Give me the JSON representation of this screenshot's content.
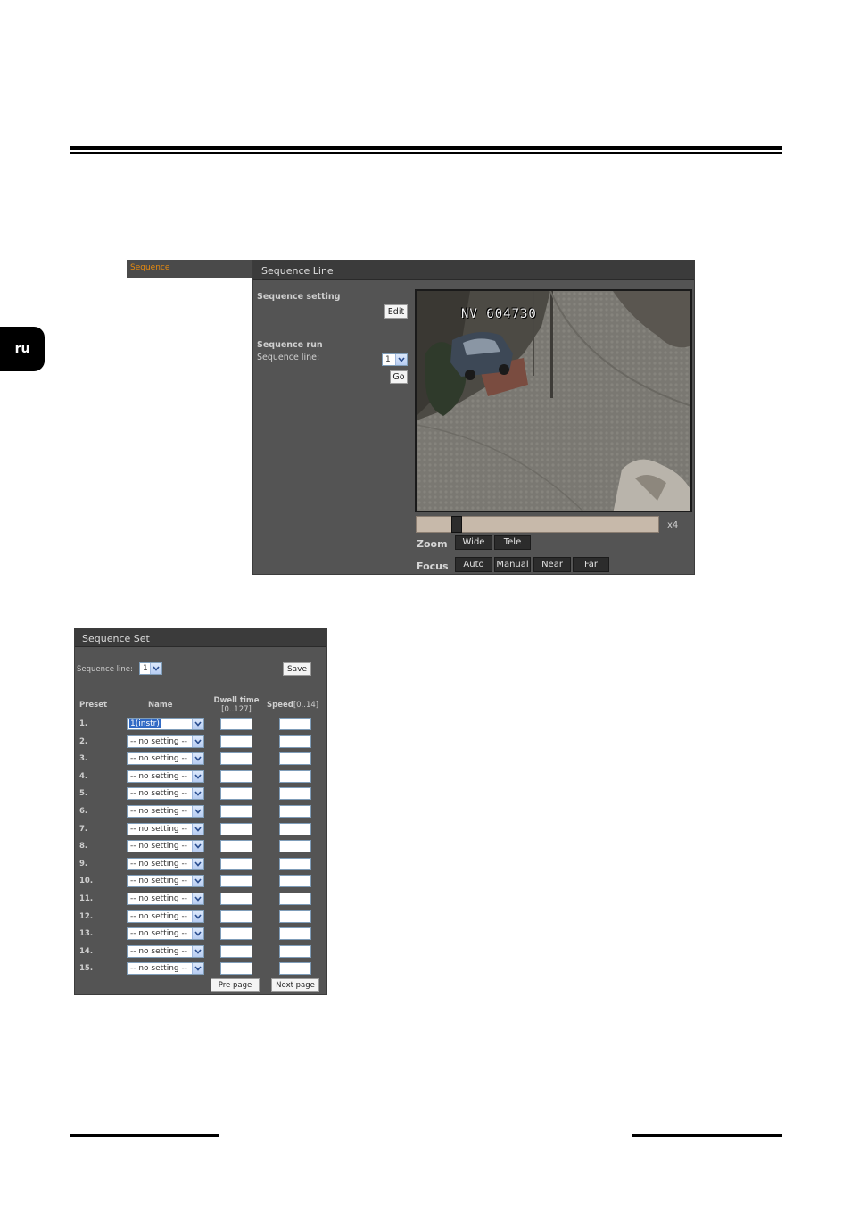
{
  "doc": {
    "lang_tab": "ru"
  },
  "shot1": {
    "menu_item": "Sequence",
    "title": "Sequence Line",
    "seq_setting_label": "Sequence setting",
    "edit_button": "Edit",
    "seq_run_label": "Sequence run",
    "seq_line_label": "Sequence line:",
    "seq_line_value": "1",
    "go_button": "Go",
    "video_overlay": "NV 604730",
    "zoom_level_label": "x4",
    "zoom_slider_fraction": 0.15,
    "zoom_label": "Zoom",
    "zoom_buttons": [
      "Wide",
      "Tele"
    ],
    "focus_label": "Focus",
    "focus_buttons": [
      "Auto",
      "Manual",
      "Near",
      "Far"
    ]
  },
  "shot2": {
    "title": "Sequence Set",
    "seq_line_label": "Sequence line:",
    "seq_line_value": "1",
    "save_button": "Save",
    "col_preset": "Preset",
    "col_name": "Name",
    "col_dwell": "Dwell time",
    "col_dwell_range": "[0..127]",
    "col_speed": "Speed",
    "col_speed_range": "[0..14]",
    "rows": [
      {
        "num": "1.",
        "name": "1(instr)"
      },
      {
        "num": "2.",
        "name": "-- no setting --"
      },
      {
        "num": "3.",
        "name": "-- no setting --"
      },
      {
        "num": "4.",
        "name": "-- no setting --"
      },
      {
        "num": "5.",
        "name": "-- no setting --"
      },
      {
        "num": "6.",
        "name": "-- no setting --"
      },
      {
        "num": "7.",
        "name": "-- no setting --"
      },
      {
        "num": "8.",
        "name": "-- no setting --"
      },
      {
        "num": "9.",
        "name": "-- no setting --"
      },
      {
        "num": "10.",
        "name": "-- no setting --"
      },
      {
        "num": "11.",
        "name": "-- no setting --"
      },
      {
        "num": "12.",
        "name": "-- no setting --"
      },
      {
        "num": "13.",
        "name": "-- no setting --"
      },
      {
        "num": "14.",
        "name": "-- no setting --"
      },
      {
        "num": "15.",
        "name": "-- no setting --"
      }
    ],
    "pre_page_button": "Pre page",
    "next_page_button": "Next page"
  },
  "colors": {
    "panel_bg": "#545454",
    "title_bar": "#3b3b3b",
    "menu_accent": "#e58a10",
    "slider_bg": "#c7b9aa"
  }
}
